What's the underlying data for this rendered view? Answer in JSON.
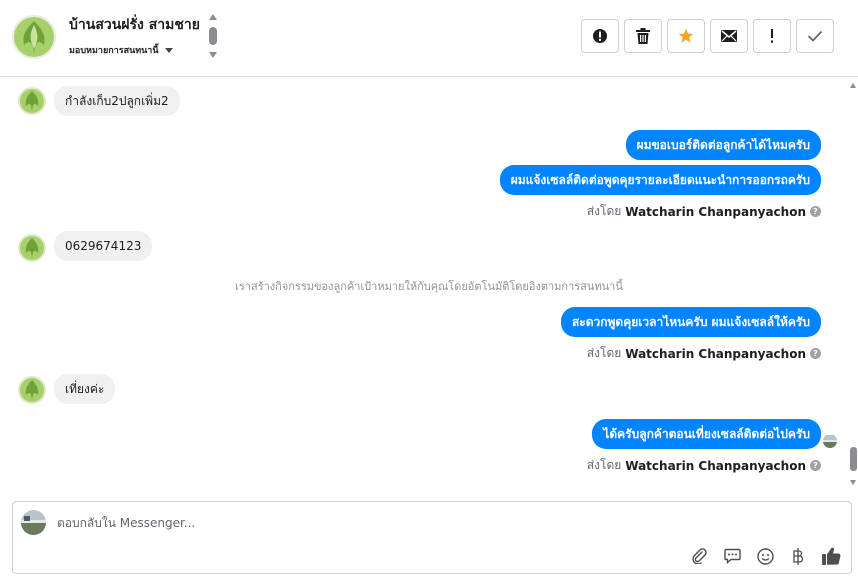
{
  "header": {
    "contact_name": "บ้านสวนฝรั่ง สามชาย",
    "assign_label": "มอบหมายการสนทนานี้"
  },
  "actions": [
    {
      "name": "mark-spam-button",
      "icon": "exclamation-circle-icon"
    },
    {
      "name": "delete-button",
      "icon": "trash-icon"
    },
    {
      "name": "star-button",
      "icon": "star-icon",
      "color": "#f5a623"
    },
    {
      "name": "mark-unread-button",
      "icon": "envelope-icon"
    },
    {
      "name": "follow-up-button",
      "icon": "exclamation-icon"
    },
    {
      "name": "mark-done-button",
      "icon": "check-icon"
    }
  ],
  "messages": {
    "m1": "กำลังเก็บ2ปลูกเพิ่ม2",
    "m2": "ผมขอเบอร์ติดต่อลูกค้าได้ไหมครับ",
    "m3": "ผมแจ้งเซลล์ติดต่อพูดคุยรายละเอียดแนะนำการออกรถครับ",
    "m4": "0629674123",
    "system_note": "เราสร้างกิจกรรมของลูกค้าเป้าหมายให้กับคุณโดยอัตโนมัติโดยอิงตามการสนทนานี้",
    "m5": "สะดวกพูดคุยเวลาไหนครับ ผมแจ้งเซลล์ให้ครับ",
    "m6": "เที่ยงค่ะ",
    "m7": "ได้ครับลูกค้าตอนเที่ยงเซลล์ติดต่อไปครับ"
  },
  "sent_by": {
    "prefix": "ส่งโดย",
    "name": "Watcharin Chanpanyachon",
    "help": "?"
  },
  "composer": {
    "placeholder": "ตอบกลับใน Messenger..."
  },
  "colors": {
    "outgoing_bubble": "#0084ff",
    "incoming_bubble": "#f0f0f0",
    "star": "#f5a623",
    "like": "#4b4f56"
  }
}
